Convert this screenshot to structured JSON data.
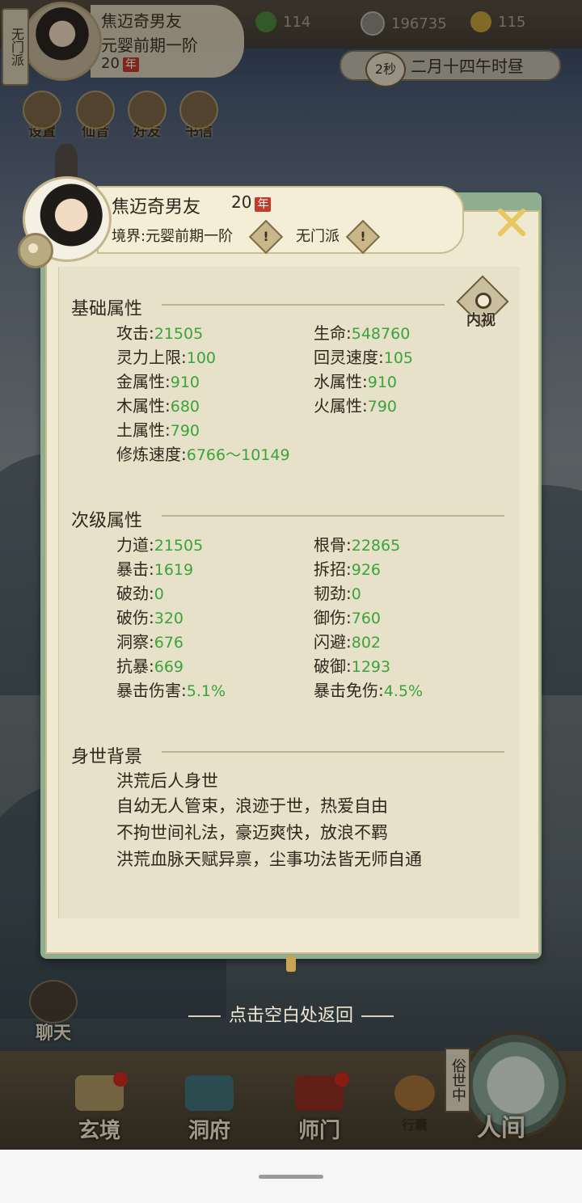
{
  "hud": {
    "sect_vertical": "无门派",
    "name": "焦迈奇男友",
    "realm": "元婴前期一阶",
    "age": "20",
    "age_badge": "年",
    "resources": [
      {
        "icon": "jade-icon",
        "value": "114"
      },
      {
        "icon": "coin-icon",
        "value": "196735"
      },
      {
        "icon": "strength-icon",
        "value": "115"
      }
    ],
    "time_seconds": "2秒",
    "date_text": "二月十四午时昼",
    "menu": [
      {
        "label": "设置",
        "icon": "settings-icon"
      },
      {
        "label": "仙音",
        "icon": "music-icon"
      },
      {
        "label": "好友",
        "icon": "friends-icon"
      },
      {
        "label": "书信",
        "icon": "letter-icon"
      }
    ]
  },
  "profile": {
    "name": "焦迈奇男友",
    "age": "20",
    "age_badge": "年",
    "realm_label": "境界:元婴前期一阶",
    "sect": "无门派",
    "warn_glyph": "!",
    "inner_view_label": "内视"
  },
  "basic": {
    "title": "基础属性",
    "stats": [
      {
        "label": "攻击",
        "value": "21505"
      },
      {
        "label": "生命",
        "value": "548760"
      },
      {
        "label": "灵力上限",
        "value": "100"
      },
      {
        "label": "回灵速度",
        "value": "105"
      },
      {
        "label": "金属性",
        "value": "910"
      },
      {
        "label": "水属性",
        "value": "910"
      },
      {
        "label": "木属性",
        "value": "680"
      },
      {
        "label": "火属性",
        "value": "790"
      },
      {
        "label": "土属性",
        "value": "790"
      },
      {
        "label": "修炼速度",
        "value": "6766～10149"
      }
    ]
  },
  "secondary": {
    "title": "次级属性",
    "stats": [
      {
        "label": "力道",
        "value": "21505"
      },
      {
        "label": "根骨",
        "value": "22865"
      },
      {
        "label": "暴击",
        "value": "1619"
      },
      {
        "label": "拆招",
        "value": "926"
      },
      {
        "label": "破劲",
        "value": "0"
      },
      {
        "label": "韧劲",
        "value": "0"
      },
      {
        "label": "破伤",
        "value": "320"
      },
      {
        "label": "御伤",
        "value": "760"
      },
      {
        "label": "洞察",
        "value": "676"
      },
      {
        "label": "闪避",
        "value": "802"
      },
      {
        "label": "抗暴",
        "value": "669"
      },
      {
        "label": "破御",
        "value": "1293"
      },
      {
        "label": "暴击伤害",
        "value": "5.1%"
      },
      {
        "label": "暴击免伤",
        "value": "4.5%"
      }
    ]
  },
  "background": {
    "title": "身世背景",
    "lines": [
      "洪荒后人身世",
      "自幼无人管束，浪迹于世，热爱自由",
      "不拘世间礼法，豪迈爽快，放浪不羁",
      "洪荒血脉天赋异禀，尘事功法皆无师自通"
    ]
  },
  "tap_return": "点击空白处返回",
  "chat_label": "聊天",
  "nav": [
    {
      "label": "玄境",
      "icon": "scroll-icon"
    },
    {
      "label": "洞府",
      "icon": "pavilion-icon"
    },
    {
      "label": "师门",
      "icon": "banner-icon"
    },
    {
      "label": "行囊",
      "icon": "bag-icon"
    }
  ],
  "world": {
    "tag": "俗世中",
    "label": "人间"
  }
}
